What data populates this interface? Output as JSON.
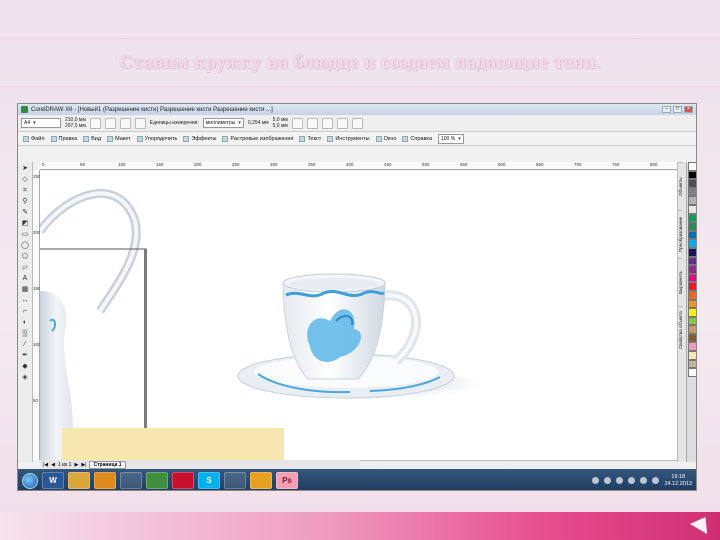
{
  "slide": {
    "title": "Ставим кружку на блюдце и создаем падающие тени."
  },
  "window": {
    "title": "CorelDRAW X6 - [Новый1 (Разрешение кисти) Разрешение кисти Разрешение кисти ...]"
  },
  "property_bar": {
    "preset": "A4",
    "width_value": "210,0 мм",
    "height_value": "297,0 мм",
    "units_label": "Единицы измерения:",
    "units_value": "миллиметры",
    "nudge_value": "0,254 мм",
    "dup_x": "5,0 мм",
    "dup_y": "5,0 мм"
  },
  "menu": {
    "items": [
      "Файл",
      "Правка",
      "Вид",
      "Макет",
      "Упорядочить",
      "Эффекты",
      "Растровые изображения",
      "Текст",
      "Инструменты",
      "Окно",
      "Справка"
    ],
    "zoom": "100 %"
  },
  "ruler": {
    "top_ticks": [
      "0",
      "50",
      "100",
      "150",
      "200",
      "250",
      "300",
      "350",
      "400",
      "450",
      "500",
      "550",
      "600",
      "650",
      "700",
      "750",
      "800"
    ],
    "left_ticks": [
      "250",
      "200",
      "150",
      "100",
      "50"
    ]
  },
  "docker": {
    "tabs": [
      "Объекты",
      "Преобразование",
      "Выровнять",
      "Свойства объекта"
    ]
  },
  "palette": {
    "colors": [
      "#ffffff",
      "#000000",
      "#4d4d4d",
      "#808080",
      "#b3b3b3",
      "#e6e6e6",
      "#00a651",
      "#2e8b57",
      "#0072bc",
      "#00aeef",
      "#1b1464",
      "#662d91",
      "#92278f",
      "#ec008c",
      "#ed1c24",
      "#f26522",
      "#f7941d",
      "#fff200",
      "#8dc63f",
      "#c69c6d",
      "#8b5a2b",
      "#f49ac1",
      "#f7e5b7",
      "#c7b299",
      "#ffffff"
    ]
  },
  "page_nav": {
    "count": "1 из 1",
    "page_tab": "Страница 1"
  },
  "taskbar": {
    "apps": [
      "W",
      "",
      "",
      "",
      "",
      "",
      "S",
      "",
      "",
      "Ps"
    ],
    "time": "19:18",
    "date": "24.12.2013"
  }
}
